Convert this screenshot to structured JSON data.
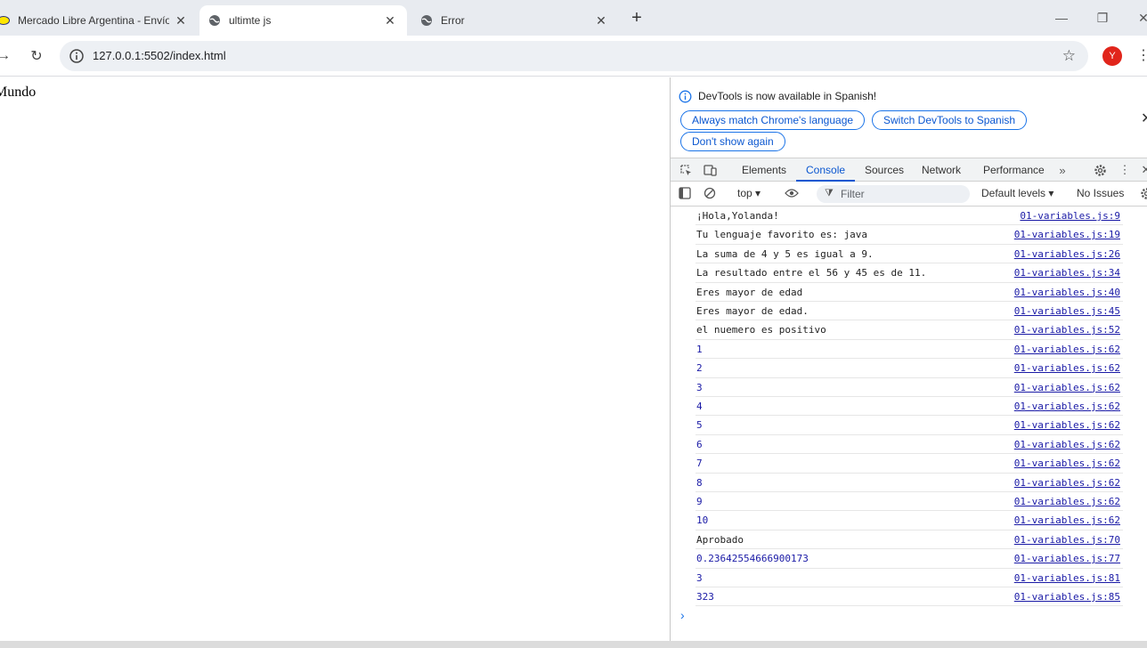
{
  "tabs": [
    {
      "title": "Mercado Libre Argentina - Envío",
      "favicon": "mercadolibre-icon"
    },
    {
      "title": "ultimte js",
      "favicon": "globe-icon"
    },
    {
      "title": "Error",
      "favicon": "globe-icon"
    }
  ],
  "address_bar": {
    "url": "127.0.0.1:5502/index.html"
  },
  "profile": {
    "initial": "Y",
    "color": "#e1251b"
  },
  "page": {
    "text": "Mundo"
  },
  "devtools": {
    "infobar": {
      "message": "DevTools is now available in Spanish!",
      "buttons": [
        "Always match Chrome's language",
        "Switch DevTools to Spanish",
        "Don't show again"
      ]
    },
    "tabs": [
      "Elements",
      "Console",
      "Sources",
      "Network",
      "Performance"
    ],
    "active_tab": "Console",
    "console_toolbar": {
      "context": "top",
      "filter_placeholder": "Filter",
      "levels": "Default levels",
      "issues": "No Issues"
    },
    "console_rows": [
      {
        "message": "¡Hola,Yolanda!",
        "source": "01-variables.js:9"
      },
      {
        "message": "Tu lenguaje favorito es: java",
        "source": "01-variables.js:19"
      },
      {
        "message": "La suma de 4 y 5 es igual a 9.",
        "source": "01-variables.js:26"
      },
      {
        "message": "La resultado entre el 56 y 45 es de 11.",
        "source": "01-variables.js:34"
      },
      {
        "message": "Eres mayor de edad",
        "source": "01-variables.js:40"
      },
      {
        "message": "Eres mayor de edad.",
        "source": "01-variables.js:45"
      },
      {
        "message": "el nuemero es positivo",
        "source": "01-variables.js:52"
      },
      {
        "message": "1",
        "source": "01-variables.js:62"
      },
      {
        "message": "2",
        "source": "01-variables.js:62"
      },
      {
        "message": "3",
        "source": "01-variables.js:62"
      },
      {
        "message": "4",
        "source": "01-variables.js:62"
      },
      {
        "message": "5",
        "source": "01-variables.js:62"
      },
      {
        "message": "6",
        "source": "01-variables.js:62"
      },
      {
        "message": "7",
        "source": "01-variables.js:62"
      },
      {
        "message": "8",
        "source": "01-variables.js:62"
      },
      {
        "message": "9",
        "source": "01-variables.js:62"
      },
      {
        "message": "10",
        "source": "01-variables.js:62"
      },
      {
        "message": "Aprobado",
        "source": "01-variables.js:70"
      },
      {
        "message": "0.23642554666900173",
        "source": "01-variables.js:77"
      },
      {
        "message": "3",
        "source": "01-variables.js:81"
      },
      {
        "message": "323",
        "source": "01-variables.js:85"
      }
    ],
    "prompt_glyph": "›"
  }
}
